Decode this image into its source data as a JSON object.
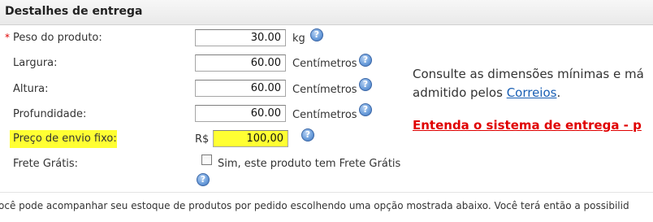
{
  "header": {
    "title": "Destalhes de entrega"
  },
  "fields": {
    "required_mark": "*",
    "peso": {
      "label": "Peso do produto:",
      "value": "30.00",
      "unit": "kg"
    },
    "largura": {
      "label": "Largura:",
      "value": "60.00",
      "unit": "Centímetros"
    },
    "altura": {
      "label": "Altura:",
      "value": "60.00",
      "unit": "Centímetros"
    },
    "profundidade": {
      "label": "Profundidade:",
      "value": "60.00",
      "unit": "Centímetros"
    },
    "preco_envio": {
      "label": "Preço de envio fixo:",
      "currency": "R$",
      "value": "100,00"
    },
    "frete_gratis": {
      "label": "Frete Grátis:",
      "checkbox_label": "Sim, este produto tem Frete Grátis",
      "checked": false
    }
  },
  "side_info": {
    "line1": "Consulte as dimensões mínimas e má",
    "line2_prefix": "admitido pelos ",
    "link_text": "Correios",
    "line2_suffix": ".",
    "red_link": "Entenda o sistema de entrega - p"
  },
  "footer_text": "ocê pode acompanhar seu estoque de produtos por pedido escolhendo uma opção mostrada abaixo. Você terá então a possibilid",
  "icons": {
    "help": "help-icon"
  },
  "colors": {
    "highlight": "#ffff33",
    "required": "#e00000",
    "red_link": "#e00000",
    "link": "#1a5fb4"
  }
}
